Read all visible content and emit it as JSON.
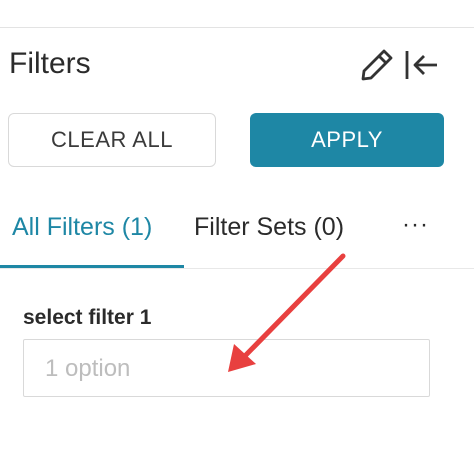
{
  "header": {
    "title": "Filters",
    "icons": [
      "pencil-icon",
      "collapse-left-icon"
    ]
  },
  "actions": {
    "clear_label": "CLEAR ALL",
    "apply_label": "APPLY"
  },
  "tabs": [
    {
      "label": "All Filters (1)",
      "active": true
    },
    {
      "label": "Filter Sets (0)",
      "active": false
    }
  ],
  "more_label": "···",
  "filter": {
    "label": "select filter 1",
    "placeholder": "1 option"
  },
  "colors": {
    "accent": "#1e87a5",
    "annotation_arrow": "#e8403f"
  }
}
